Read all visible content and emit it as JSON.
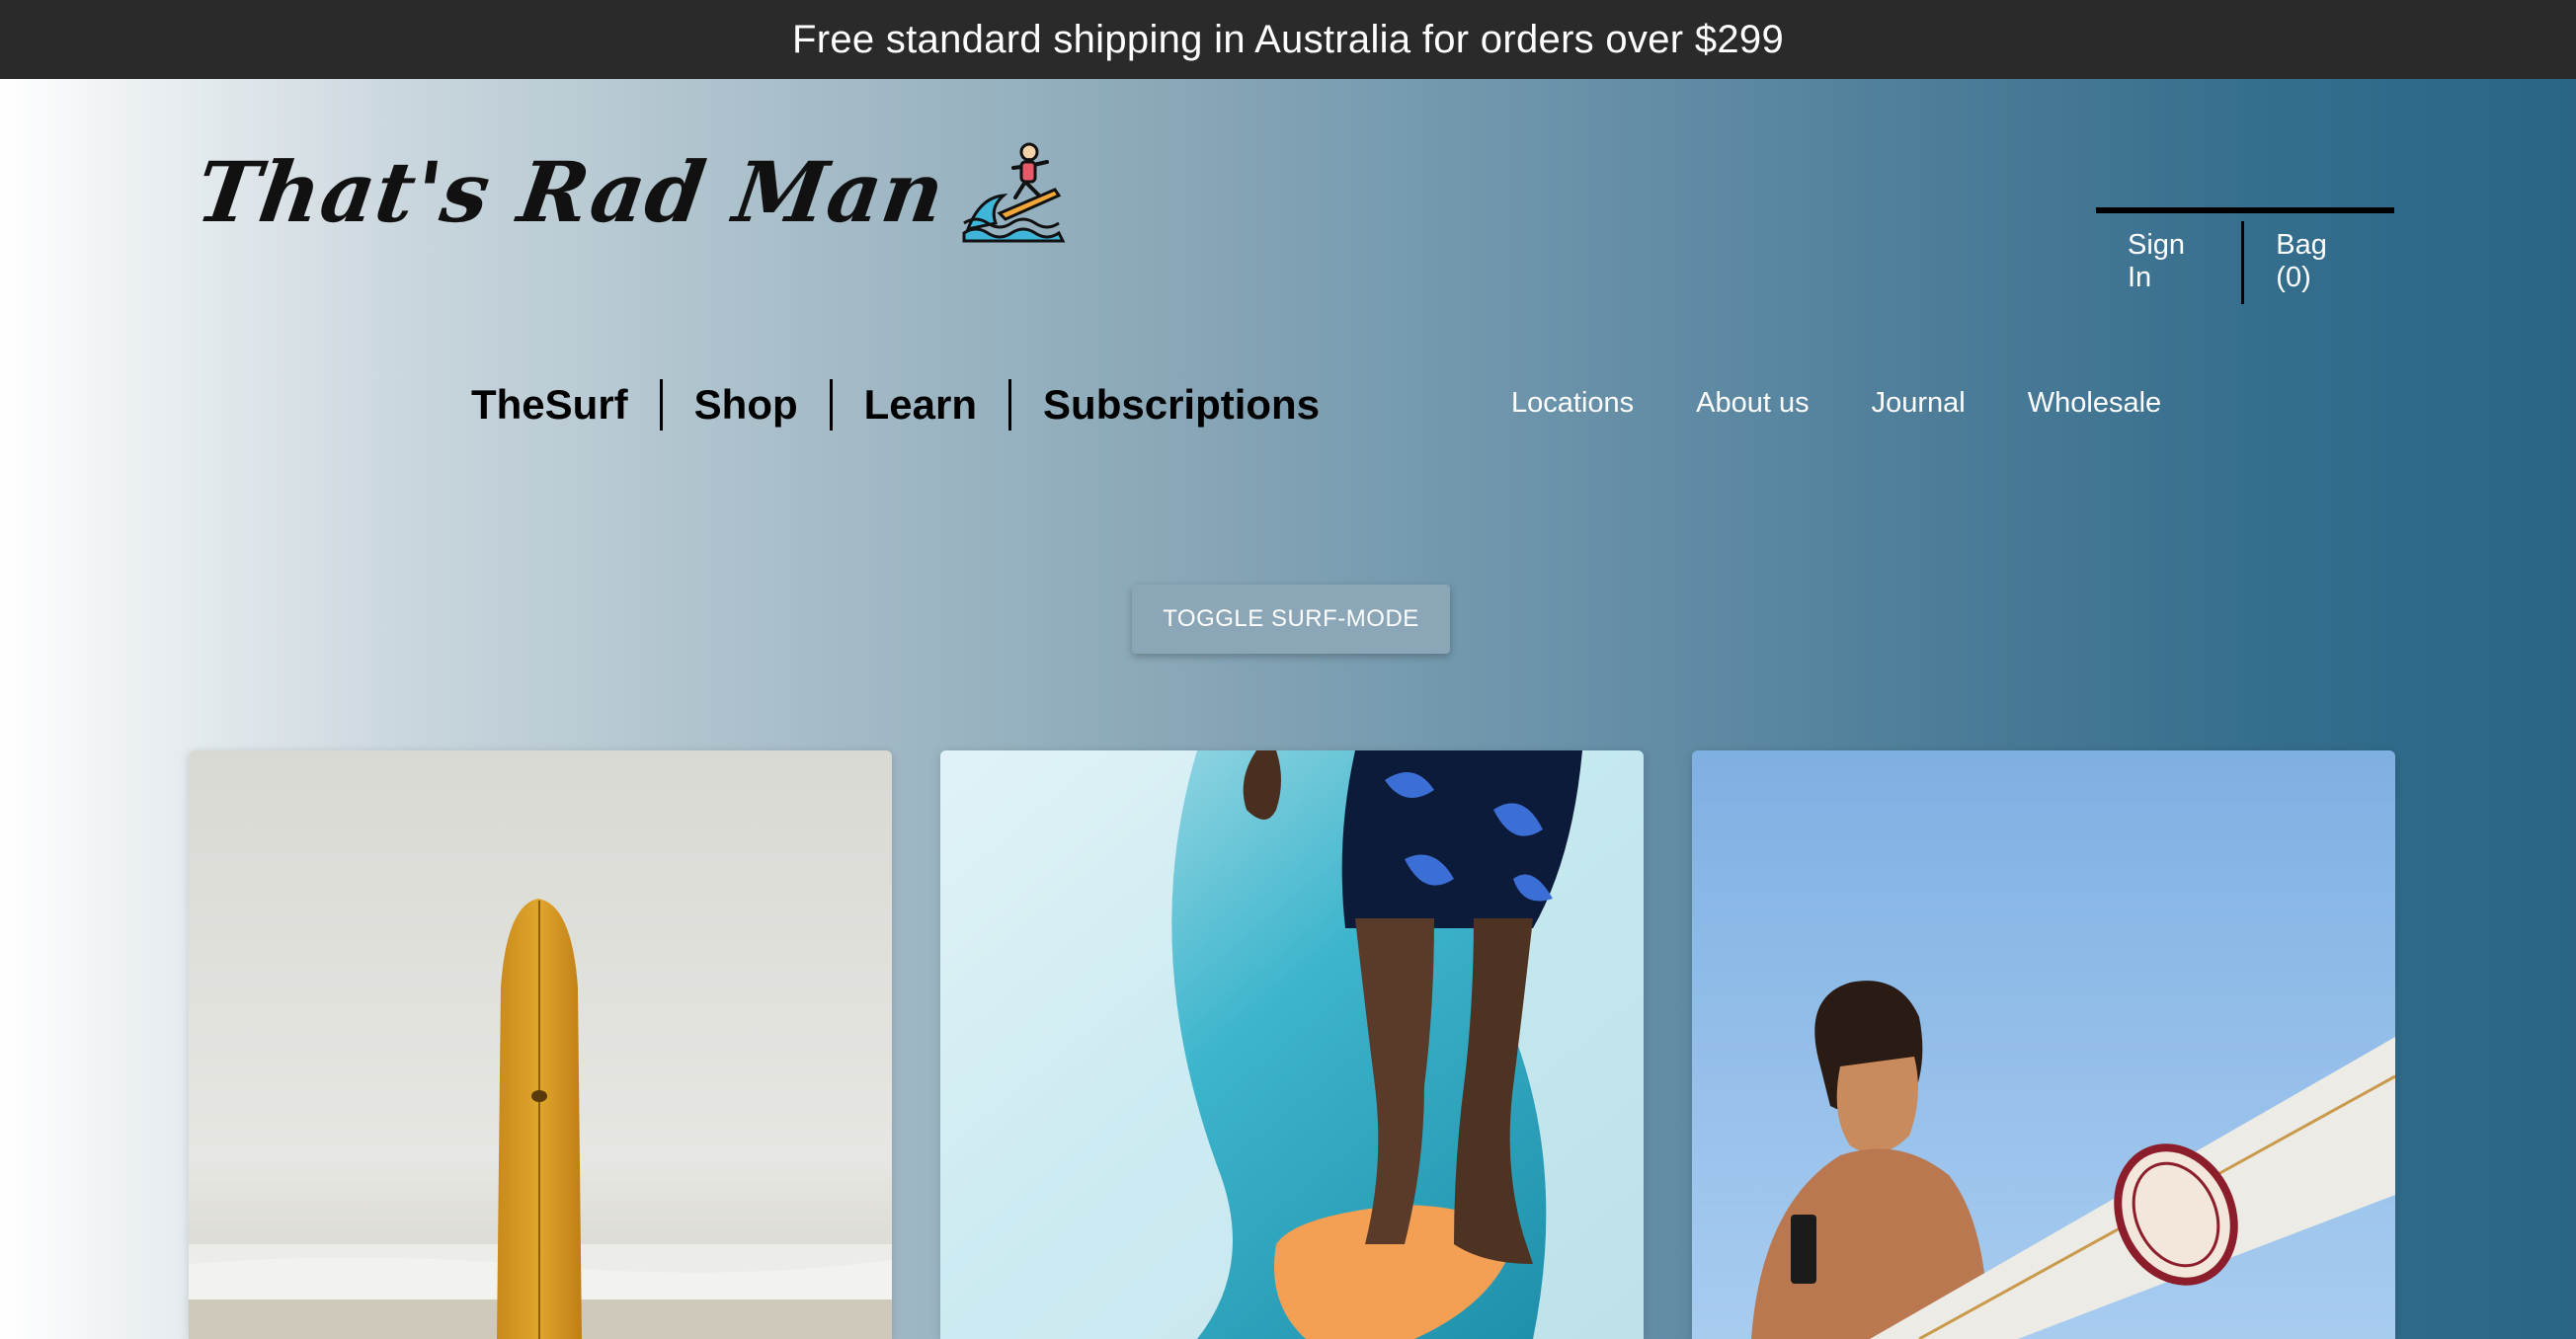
{
  "announcement": {
    "text": "Free standard shipping in Australia for orders over $299"
  },
  "brand": {
    "logo_text": "That's Rad Man",
    "logo_icon": "surfer-wave-icon"
  },
  "account": {
    "sign_in": "Sign In",
    "bag": "Bag (0)"
  },
  "main_nav": {
    "items": [
      {
        "label": "TheSurf"
      },
      {
        "label": "Shop"
      },
      {
        "label": "Learn"
      },
      {
        "label": "Subscriptions"
      }
    ]
  },
  "secondary_nav": {
    "items": [
      {
        "label": "Locations"
      },
      {
        "label": "About us"
      },
      {
        "label": "Journal"
      },
      {
        "label": "Wholesale"
      }
    ]
  },
  "toggle": {
    "label": "TOGGLE SURF-MODE"
  },
  "cards": [
    {
      "image": "yellow-surfboard-photo"
    },
    {
      "image": "surfer-riding-wave-photo"
    },
    {
      "image": "surfer-carrying-board-photo"
    }
  ],
  "colors": {
    "topbar_bg": "#2a2a2a",
    "gradient_start": "#ffffff",
    "gradient_end": "#2a6586",
    "toggle_bg": "#8ba6b6"
  }
}
